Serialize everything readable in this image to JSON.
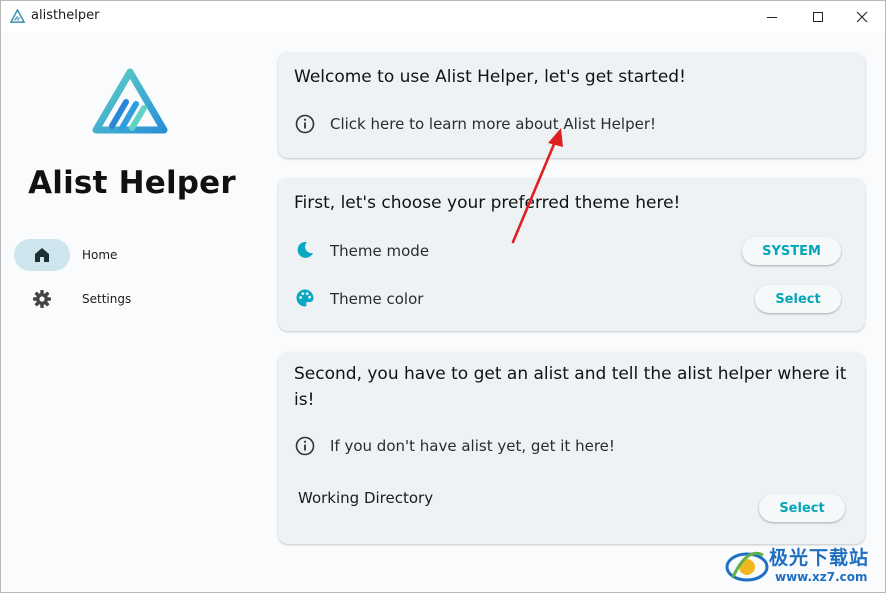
{
  "window": {
    "title": "alisthelper"
  },
  "sidebar": {
    "brand": "Alist Helper",
    "items": [
      {
        "label": "Home",
        "icon": "home-icon",
        "selected": true
      },
      {
        "label": "Settings",
        "icon": "gear-icon",
        "selected": false
      }
    ]
  },
  "welcome": {
    "title": "Welcome to use Alist Helper, let's get started!",
    "link_text": "Click here to learn more about Alist Helper!"
  },
  "theme": {
    "title": "First, let's choose your preferred theme here!",
    "mode_label": "Theme mode",
    "mode_value": "SYSTEM",
    "color_label": "Theme color",
    "color_button": "Select"
  },
  "alist": {
    "title": "Second, you have to get an alist and tell the alist helper where it is!",
    "info_text": "If you don't have alist yet, get it here!",
    "working_directory_label": "Working Directory",
    "working_directory_button": "Select"
  },
  "watermark": {
    "name": "极光下载站",
    "url": "www.xz7.com"
  },
  "colors": {
    "accent": "#05a6b8",
    "card": "#eef2f4",
    "selected_nav": "#cfe5ee",
    "annotation_arrow": "#e02020"
  }
}
